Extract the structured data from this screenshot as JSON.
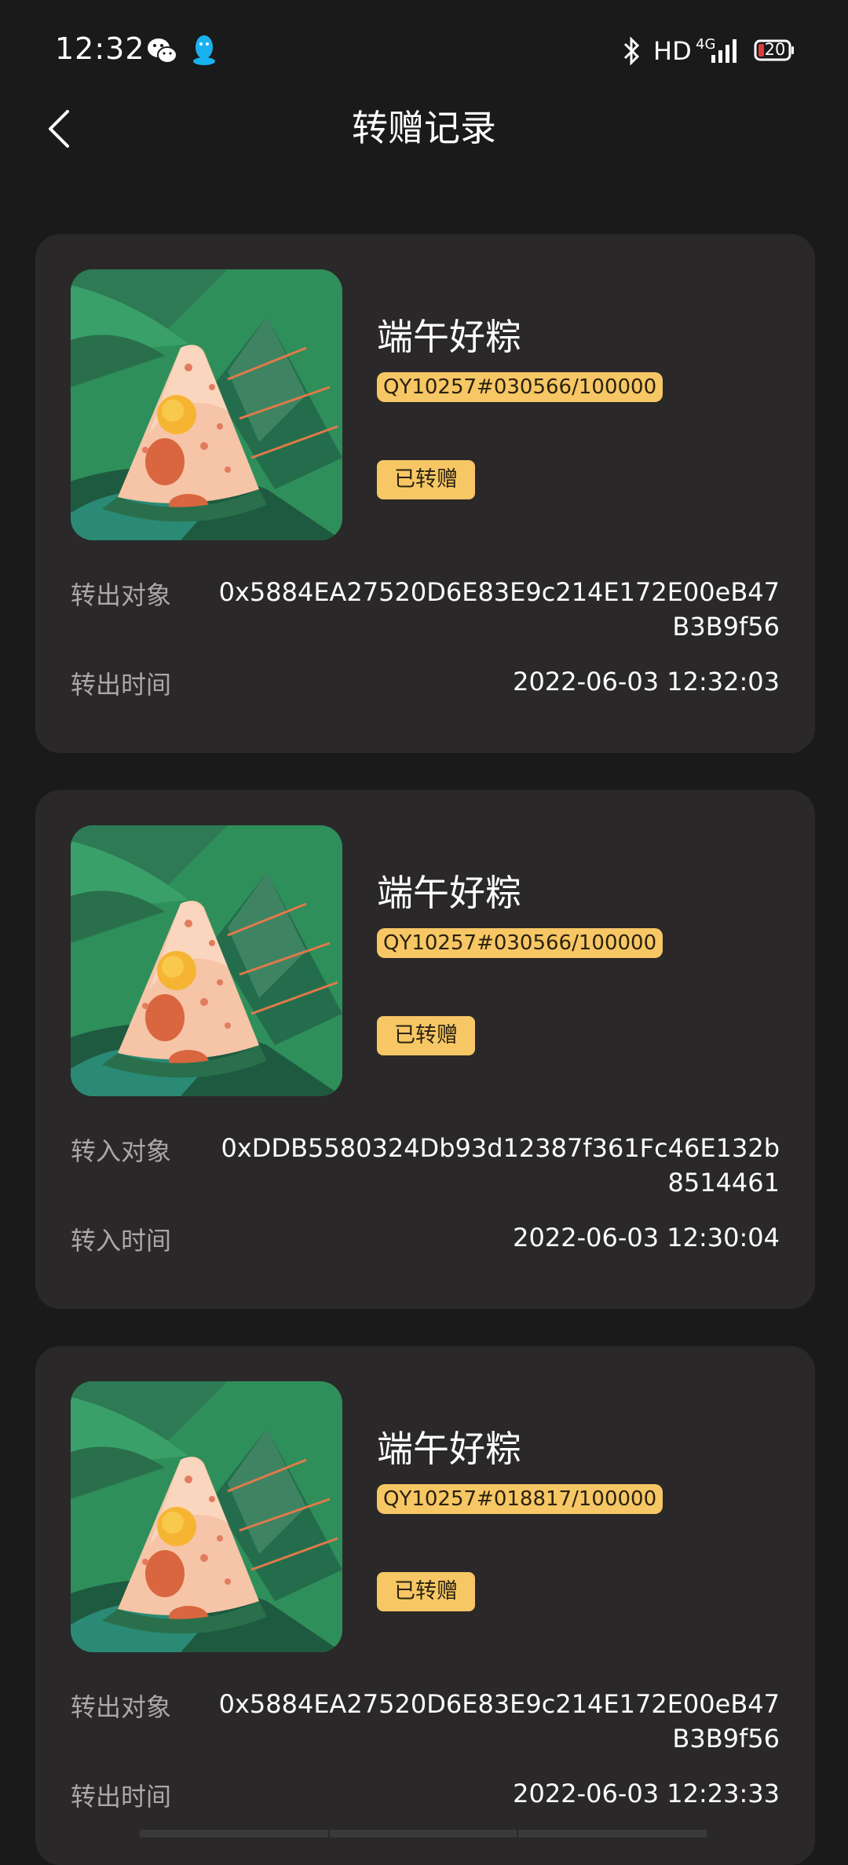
{
  "status_bar": {
    "time": "12:32",
    "hd": "HD",
    "network": "4G",
    "battery": "20",
    "icons": [
      "wechat-icon",
      "qq-icon",
      "bluetooth-icon",
      "signal-icon",
      "battery-icon"
    ]
  },
  "header": {
    "title": "转赠记录",
    "back_icon": "chevron-left-icon"
  },
  "colors": {
    "background": "#1b1a1b",
    "card": "#2b2829",
    "badge": "#f7c765",
    "label": "#a9a7a8"
  },
  "records": [
    {
      "name": "端午好粽",
      "serial": "QY10257#030566/100000",
      "status": "已转赠",
      "target_label": "转出对象",
      "target_value": "0x5884EA27520D6E83E9c214E172E00eB47B3B9f56",
      "time_label": "转出时间",
      "time_value": "2022-06-03 12:32:03"
    },
    {
      "name": "端午好粽",
      "serial": "QY10257#030566/100000",
      "status": "已转赠",
      "target_label": "转入对象",
      "target_value": "0xDDB5580324Db93d12387f361Fc46E132b8514461",
      "time_label": "转入时间",
      "time_value": "2022-06-03 12:30:04"
    },
    {
      "name": "端午好粽",
      "serial": "QY10257#018817/100000",
      "status": "已转赠",
      "target_label": "转出对象",
      "target_value": "0x5884EA27520D6E83E9c214E172E00eB47B3B9f56",
      "time_label": "转出时间",
      "time_value": "2022-06-03 12:23:33"
    }
  ]
}
